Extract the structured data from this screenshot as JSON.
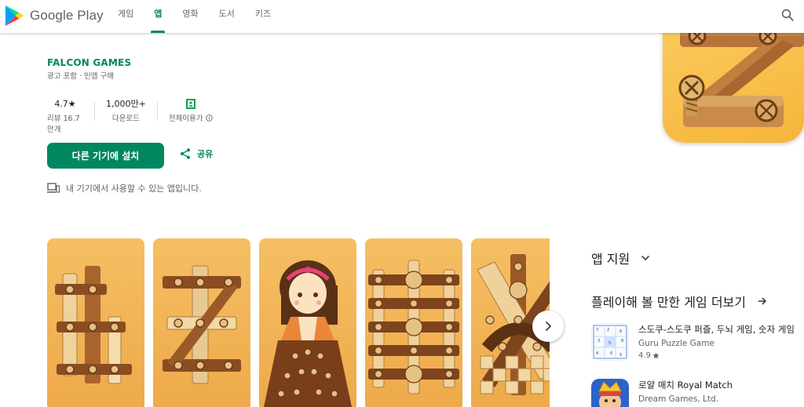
{
  "header": {
    "logo_text": "Google Play",
    "nav": [
      {
        "label": "게임",
        "active": false
      },
      {
        "label": "앱",
        "active": true
      },
      {
        "label": "영화",
        "active": false
      },
      {
        "label": "도서",
        "active": false
      },
      {
        "label": "키즈",
        "active": false
      }
    ],
    "search_icon": "search-icon"
  },
  "app": {
    "developer": "FALCON GAMES",
    "ads_note": "광고 포함 · 인앱 구매",
    "stats": {
      "rating_value": "4.7★",
      "rating_label": "리뷰 16.7만개",
      "downloads_value": "1,000만+",
      "downloads_label": "다운로드",
      "content_rating_label": "전체이용가"
    },
    "install_label": "다른 기기에 설치",
    "share_label": "공유",
    "device_note": "내 기기에서 사용할 수 있는 앱입니다."
  },
  "sidebar": {
    "app_support_label": "앱 지원",
    "similar_label": "플레이해 볼 만한 게임 더보기",
    "games": [
      {
        "title": "스도쿠-스도쿠 퍼즐, 두뇌 게임, 숫자 게임",
        "developer": "Guru Puzzle Game",
        "rating": "4.9"
      },
      {
        "title": "로얄 매치 Royal Match",
        "developer": "Dream Games, Ltd."
      }
    ]
  },
  "colors": {
    "accent": "#01875f",
    "wood_light": "#e2b872",
    "wood_dark": "#9a5a28",
    "screen_bg": "#f5bf63"
  }
}
